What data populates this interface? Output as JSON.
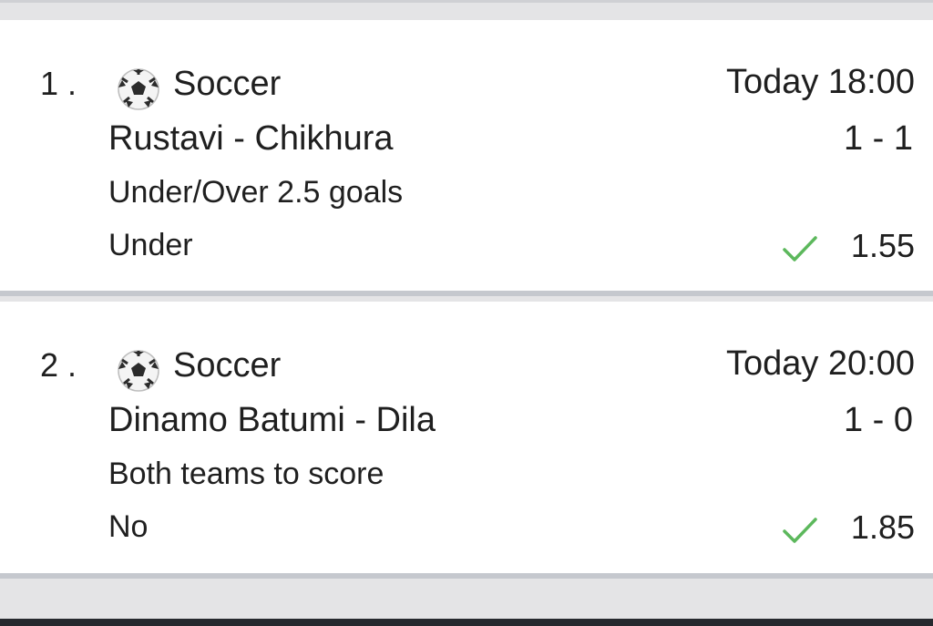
{
  "colors": {
    "check": "#5cb85c",
    "divider": "#c5c8ce",
    "background": "#e4e4e6",
    "card": "#ffffff"
  },
  "bets": [
    {
      "index": "1 .",
      "sport_icon": "soccer-ball-icon",
      "sport": "Soccer",
      "time": "Today 18:00",
      "match": "Rustavi - Chikhura",
      "score": "1 - 1",
      "market": "Under/Over 2.5 goals",
      "pick": "Under",
      "status_icon": "check-icon",
      "odds": "1.55"
    },
    {
      "index": "2 .",
      "sport_icon": "soccer-ball-icon",
      "sport": "Soccer",
      "time": "Today 20:00",
      "match": "Dinamo Batumi - Dila",
      "score": "1 - 0",
      "market": "Both teams to score",
      "pick": "No",
      "status_icon": "check-icon",
      "odds": "1.85"
    }
  ]
}
